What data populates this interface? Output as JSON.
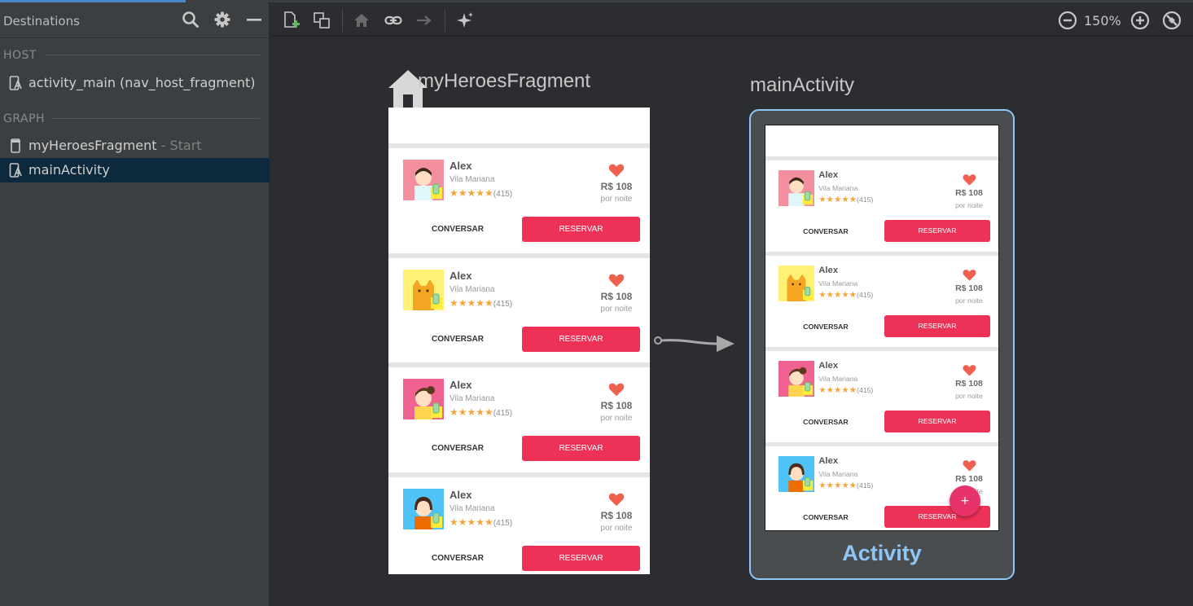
{
  "panel": {
    "title": "Destinations",
    "host_label": "HOST",
    "graph_label": "GRAPH",
    "host_items": [
      {
        "label": "activity_main (nav_host_fragment)",
        "sub": ""
      }
    ],
    "graph_items": [
      {
        "label": "myHeroesFragment",
        "sub": " - Start"
      },
      {
        "label": "mainActivity",
        "sub": ""
      }
    ]
  },
  "toolbar": {
    "zoom": "150%"
  },
  "canvas": {
    "fragment_title": "myHeroesFragment",
    "activity_title": "mainActivity",
    "activity_label": "Activity",
    "fab_glyph": "+"
  },
  "cards": [
    {
      "name": "Alex",
      "location": "Vila Mariana",
      "stars": "★★★★★",
      "reviews": "(415)",
      "price": "R$ 108",
      "per": "por noite",
      "chat": "CONVERSAR",
      "book": "RESERVAR",
      "avatar_bg": "#f48fa0",
      "avatar_icon": "boy-avatar-icon"
    },
    {
      "name": "Alex",
      "location": "Vila Mariana",
      "stars": "★★★★★",
      "reviews": "(415)",
      "price": "R$ 108",
      "per": "por noite",
      "chat": "CONVERSAR",
      "book": "RESERVAR",
      "avatar_bg": "#fff176",
      "avatar_icon": "cat-avatar-icon"
    },
    {
      "name": "Alex",
      "location": "Vila Mariana",
      "stars": "★★★★★",
      "reviews": "(415)",
      "price": "R$ 108",
      "per": "por noite",
      "chat": "CONVERSAR",
      "book": "RESERVAR",
      "avatar_bg": "#f06292",
      "avatar_icon": "girl-avatar-icon"
    },
    {
      "name": "Alex",
      "location": "Vila Mariana",
      "stars": "★★★★★",
      "reviews": "(415)",
      "price": "R$ 108",
      "per": "por noite",
      "chat": "CONVERSAR",
      "book": "RESERVAR",
      "avatar_bg": "#4fc3f7",
      "avatar_icon": "woman-avatar-icon"
    }
  ],
  "colors": {
    "accent_blue": "#8ec6f7",
    "primary_button": "#ee3156",
    "heart": "#f0604e",
    "star": "#f3a43a"
  }
}
